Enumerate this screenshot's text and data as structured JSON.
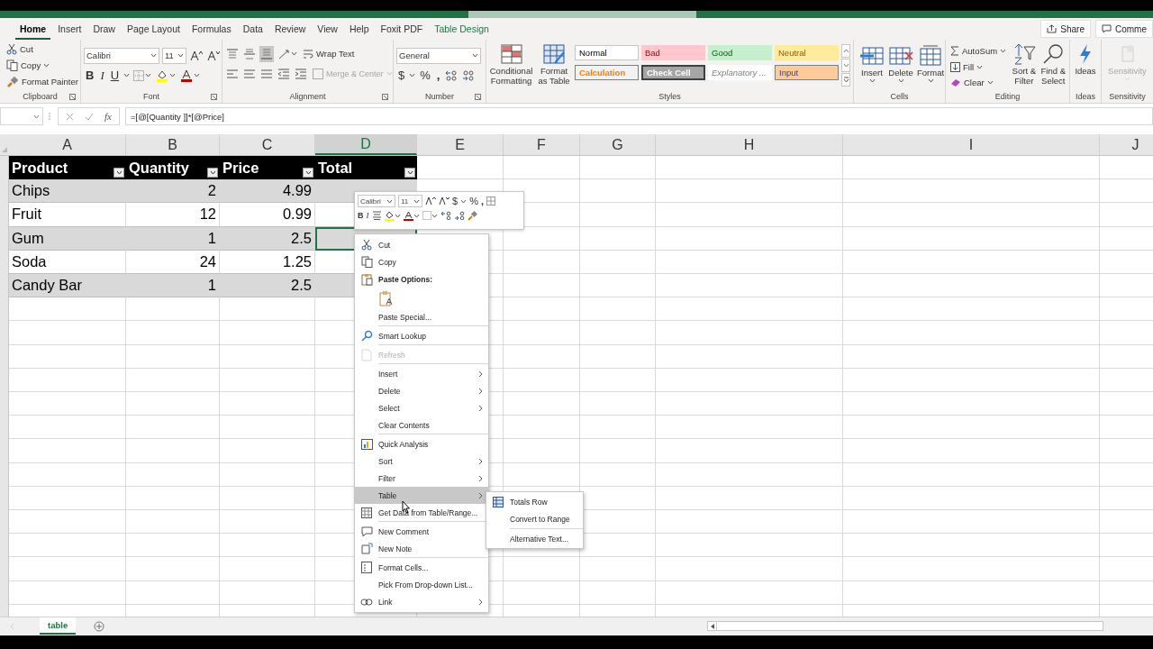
{
  "ribbon": {
    "tabs": [
      {
        "label": "Home",
        "selected": true,
        "kind": "normal"
      },
      {
        "label": "Insert",
        "selected": false,
        "kind": "normal"
      },
      {
        "label": "Draw",
        "selected": false,
        "kind": "normal"
      },
      {
        "label": "Page Layout",
        "selected": false,
        "kind": "normal"
      },
      {
        "label": "Formulas",
        "selected": false,
        "kind": "normal"
      },
      {
        "label": "Data",
        "selected": false,
        "kind": "normal"
      },
      {
        "label": "Review",
        "selected": false,
        "kind": "normal"
      },
      {
        "label": "View",
        "selected": false,
        "kind": "normal"
      },
      {
        "label": "Help",
        "selected": false,
        "kind": "normal"
      },
      {
        "label": "Foxit PDF",
        "selected": false,
        "kind": "normal"
      },
      {
        "label": "Table Design",
        "selected": false,
        "kind": "contextual"
      }
    ],
    "share": "Share",
    "comments": "Comme",
    "clipboard": {
      "cut": "Cut",
      "copy": "Copy",
      "format_painter": "Format Painter",
      "label": "Clipboard"
    },
    "font": {
      "font_name": "Calibri",
      "font_size": "11",
      "bold": "B",
      "italic": "I",
      "underline": "U",
      "label": "Font"
    },
    "alignment": {
      "vertical": [
        {
          "selected": false
        },
        {
          "selected": false
        },
        {
          "selected": true
        }
      ],
      "wrap_text": "Wrap Text",
      "merge_center": "Merge & Center",
      "merge_disabled": true,
      "label": "Alignment"
    },
    "number": {
      "format": "General",
      "currency": "$",
      "percent": "%",
      "comma": ",",
      "label": "Number"
    },
    "styles": {
      "conditional_formatting": "Conditional Formatting",
      "format_as_table": "Format as Table",
      "gallery": [
        {
          "label": "Normal",
          "kind": "normal"
        },
        {
          "label": "Bad",
          "kind": "bad"
        },
        {
          "label": "Good",
          "kind": "good"
        },
        {
          "label": "Neutral",
          "kind": "neutral"
        },
        {
          "label": "Calculation",
          "kind": "calculation"
        },
        {
          "label": "Check Cell",
          "kind": "check"
        },
        {
          "label": "Explanatory ...",
          "kind": "explanatory"
        },
        {
          "label": "Input",
          "kind": "input"
        }
      ],
      "label": "Styles"
    },
    "cells": {
      "buttons": [
        "Insert",
        "Delete",
        "Format"
      ],
      "label": "Cells"
    },
    "editing": {
      "autosum": "AutoSum",
      "fill": "Fill",
      "clear": "Clear",
      "sort_filter": "Sort & Filter",
      "find_select": "Find & Select",
      "label": "Editing"
    },
    "ideas": {
      "button": "Ideas",
      "label": "Ideas"
    },
    "sensitivity": {
      "button": "Sensitivity",
      "disabled": true,
      "label": "Sensitivity"
    }
  },
  "formula_bar": {
    "insert_function": "fx",
    "formula": "=[@[Quantity ]]*[@Price]"
  },
  "columns": [
    {
      "label": "A",
      "selected": false
    },
    {
      "label": "B",
      "selected": false
    },
    {
      "label": "C",
      "selected": false
    },
    {
      "label": "D",
      "selected": true
    },
    {
      "label": "E",
      "selected": false
    },
    {
      "label": "F",
      "selected": false
    },
    {
      "label": "G",
      "selected": false
    },
    {
      "label": "H",
      "selected": false
    },
    {
      "label": "I",
      "selected": false
    },
    {
      "label": "J",
      "selected": false
    }
  ],
  "table": {
    "headers": [
      "Product",
      "Quantity",
      "Price",
      "Total"
    ],
    "rows": [
      {
        "cells": [
          "Chips",
          "2",
          "4.99"
        ],
        "selected": false
      },
      {
        "cells": [
          "Fruit",
          "12",
          "0.99"
        ],
        "selected": false
      },
      {
        "cells": [
          "Gum",
          "1",
          "2.5"
        ],
        "selected": true
      },
      {
        "cells": [
          "Soda",
          "24",
          "1.25"
        ],
        "selected": false
      },
      {
        "cells": [
          "Candy Bar",
          "1",
          "2.5"
        ],
        "selected": false
      }
    ]
  },
  "mini_toolbar": {
    "font_name": "Calibri",
    "font_size": "11",
    "currency": "$",
    "percent": "%",
    "comma": ",",
    "bold": "B",
    "italic": "I"
  },
  "context_menu": {
    "items": [
      {
        "label": "Cut",
        "kind": "item",
        "disabled": false,
        "submenu": false,
        "selected": false,
        "separator_before": false
      },
      {
        "label": "Copy",
        "kind": "item",
        "disabled": false,
        "submenu": false,
        "selected": false,
        "separator_before": false
      },
      {
        "label": "Paste Options:",
        "kind": "header"
      },
      {
        "kind": "paste_icons"
      },
      {
        "label": "Paste Special...",
        "kind": "item",
        "disabled": false,
        "submenu": false,
        "selected": false,
        "separator_before": false
      },
      {
        "label": "Smart Lookup",
        "kind": "item",
        "disabled": false,
        "submenu": false,
        "selected": false,
        "separator_before": true
      },
      {
        "label": "Refresh",
        "kind": "item",
        "disabled": true,
        "submenu": false,
        "selected": false,
        "separator_before": true
      },
      {
        "label": "Insert",
        "kind": "item",
        "disabled": false,
        "submenu": true,
        "selected": false,
        "separator_before": true
      },
      {
        "label": "Delete",
        "kind": "item",
        "disabled": false,
        "submenu": true,
        "selected": false,
        "separator_before": false
      },
      {
        "label": "Select",
        "kind": "item",
        "disabled": false,
        "submenu": true,
        "selected": false,
        "separator_before": false
      },
      {
        "label": "Clear Contents",
        "kind": "item",
        "disabled": false,
        "submenu": false,
        "selected": false,
        "separator_before": false
      },
      {
        "label": "Quick Analysis",
        "kind": "item",
        "disabled": false,
        "submenu": false,
        "selected": false,
        "separator_before": true
      },
      {
        "label": "Sort",
        "kind": "item",
        "disabled": false,
        "submenu": true,
        "selected": false,
        "separator_before": false
      },
      {
        "label": "Filter",
        "kind": "item",
        "disabled": false,
        "submenu": true,
        "selected": false,
        "separator_before": false
      },
      {
        "label": "Table",
        "kind": "item",
        "disabled": false,
        "submenu": true,
        "selected": true,
        "separator_before": false
      },
      {
        "label": "Get Data from Table/Range...",
        "kind": "item",
        "disabled": false,
        "submenu": false,
        "selected": false,
        "separator_before": false
      },
      {
        "label": "New Comment",
        "kind": "item",
        "disabled": false,
        "submenu": false,
        "selected": false,
        "separator_before": true
      },
      {
        "label": "New Note",
        "kind": "item",
        "disabled": false,
        "submenu": false,
        "selected": false,
        "separator_before": false
      },
      {
        "label": "Format Cells...",
        "kind": "item",
        "disabled": false,
        "submenu": false,
        "selected": false,
        "separator_before": true
      },
      {
        "label": "Pick From Drop-down List...",
        "kind": "item",
        "disabled": false,
        "submenu": false,
        "selected": false,
        "separator_before": false
      },
      {
        "label": "Link",
        "kind": "item",
        "disabled": false,
        "submenu": true,
        "selected": false,
        "separator_before": false
      }
    ]
  },
  "submenu": {
    "items": [
      {
        "label": "Totals Row",
        "separator_before": false
      },
      {
        "label": "Convert to Range",
        "separator_before": false
      },
      {
        "label": "Alternative Text...",
        "separator_before": true
      }
    ]
  },
  "sheet_tabs": [
    {
      "label": "table",
      "selected": true
    }
  ]
}
